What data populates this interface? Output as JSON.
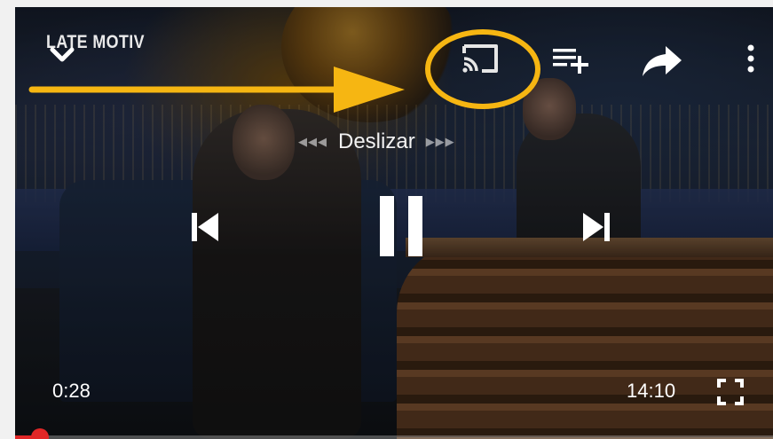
{
  "player": {
    "channel_logo_text": "LATE MOTIV",
    "seek_hint": {
      "label": "Deslizar",
      "left_arrows": "◀◀◀",
      "right_arrows": "▶▶▶"
    },
    "current_time": "0:28",
    "duration": "14:10",
    "progress_fraction": 0.033
  },
  "icons": {
    "collapse": "chevron-down-icon",
    "cast": "cast-icon",
    "add_to_queue": "playlist-add-icon",
    "share": "share-icon",
    "more": "more-vertical-icon",
    "previous": "skip-previous-icon",
    "play_pause": "pause-icon",
    "next": "skip-next-icon",
    "fullscreen": "fullscreen-icon"
  },
  "annotation": {
    "color": "#f6b612",
    "kind": "arrow-and-circle-highlighting-cast-button"
  },
  "colors": {
    "progress": "#e02727",
    "frame_background": "#f1f1f1"
  }
}
